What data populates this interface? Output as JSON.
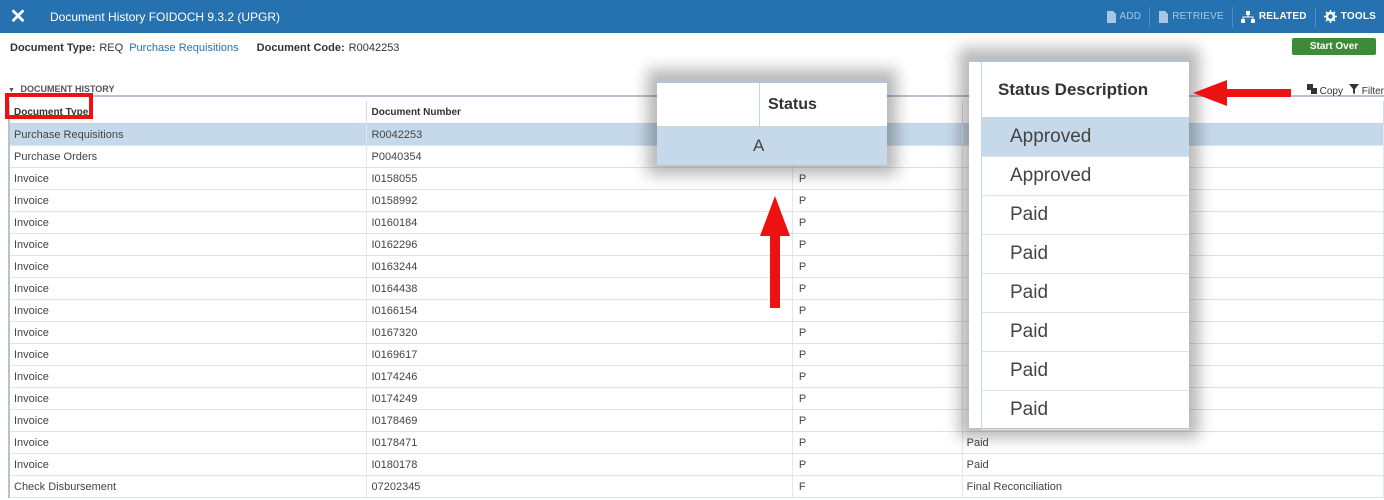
{
  "window": {
    "title": "Document History FOIDOCH 9.3.2 (UPGR)",
    "toolbar": {
      "add": "ADD",
      "retrieve": "RETRIEVE",
      "related": "RELATED",
      "tools": "TOOLS"
    }
  },
  "key_block": {
    "doc_type_label": "Document Type:",
    "doc_type_value": "REQ",
    "doc_type_desc": "Purchase Requisitions",
    "doc_code_label": "Document Code:",
    "doc_code_value": "R0042253",
    "start_over": "Start Over"
  },
  "section": {
    "title": "DOCUMENT HISTORY",
    "copy": "Copy",
    "filter": "Filter"
  },
  "grid": {
    "headers": [
      "Document Type",
      "Document Number",
      "",
      ""
    ],
    "rows": [
      {
        "type": "Purchase Requisitions",
        "number": "R0042253",
        "status": "",
        "desc": ""
      },
      {
        "type": "Purchase Orders",
        "number": "P0040354",
        "status": "",
        "desc": ""
      },
      {
        "type": "Invoice",
        "number": "I0158055",
        "status": "P",
        "desc": ""
      },
      {
        "type": "Invoice",
        "number": "I0158992",
        "status": "P",
        "desc": ""
      },
      {
        "type": "Invoice",
        "number": "I0160184",
        "status": "P",
        "desc": ""
      },
      {
        "type": "Invoice",
        "number": "I0162296",
        "status": "P",
        "desc": ""
      },
      {
        "type": "Invoice",
        "number": "I0163244",
        "status": "P",
        "desc": ""
      },
      {
        "type": "Invoice",
        "number": "I0164438",
        "status": "P",
        "desc": ""
      },
      {
        "type": "Invoice",
        "number": "I0166154",
        "status": "P",
        "desc": ""
      },
      {
        "type": "Invoice",
        "number": "I0167320",
        "status": "P",
        "desc": ""
      },
      {
        "type": "Invoice",
        "number": "I0169617",
        "status": "P",
        "desc": ""
      },
      {
        "type": "Invoice",
        "number": "I0174246",
        "status": "P",
        "desc": ""
      },
      {
        "type": "Invoice",
        "number": "I0174249",
        "status": "P",
        "desc": ""
      },
      {
        "type": "Invoice",
        "number": "I0178469",
        "status": "P",
        "desc": ""
      },
      {
        "type": "Invoice",
        "number": "I0178471",
        "status": "P",
        "desc": "Paid"
      },
      {
        "type": "Invoice",
        "number": "I0180178",
        "status": "P",
        "desc": "Paid"
      },
      {
        "type": "Check Disbursement",
        "number": "07202345",
        "status": "F",
        "desc": "Final Reconciliation"
      }
    ]
  },
  "zoom_status": {
    "header": "Status",
    "value": "A"
  },
  "zoom_desc": {
    "header": "Status Description",
    "values": [
      "Approved",
      "Approved",
      "Paid",
      "Paid",
      "Paid",
      "Paid",
      "Paid",
      "Paid"
    ]
  },
  "colors": {
    "topbar": "#2672b0",
    "start_over": "#3d8b37",
    "selected_row": "#c6d9ea",
    "annotation": "#ee1111"
  }
}
